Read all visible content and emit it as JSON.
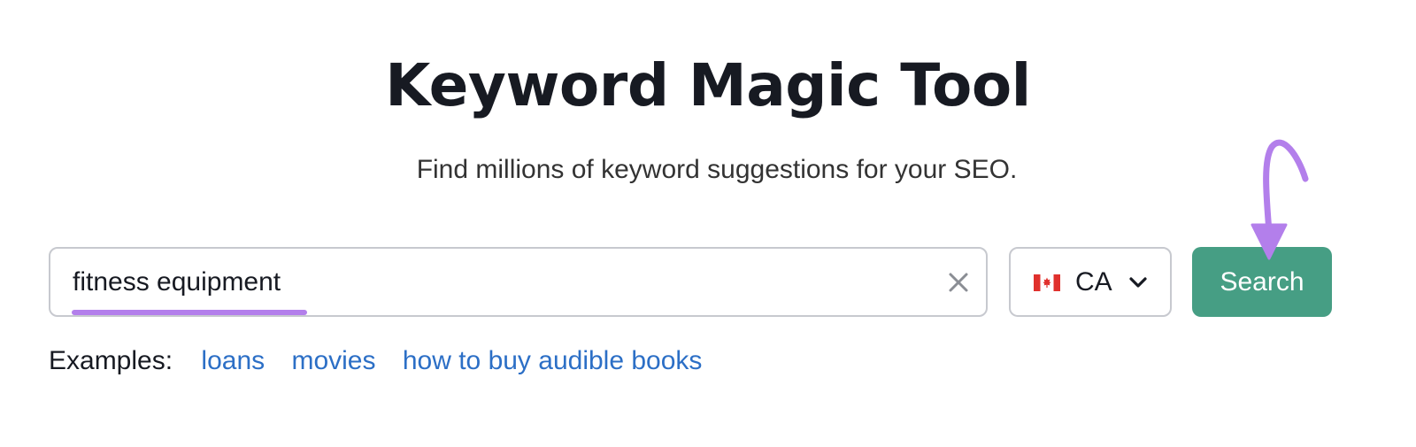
{
  "header": {
    "title": "Keyword Magic Tool",
    "subtitle": "Find millions of keyword suggestions for your SEO."
  },
  "search": {
    "value": "fitness equipment",
    "clear_icon": "close-icon"
  },
  "country": {
    "code": "CA",
    "flag_icon": "canada-flag-icon",
    "dropdown_icon": "chevron-down-icon"
  },
  "search_button": {
    "label": "Search"
  },
  "examples": {
    "label": "Examples:",
    "links": [
      "loans",
      "movies",
      "how to buy audible books"
    ]
  },
  "colors": {
    "accent_green": "#469e84",
    "link_blue": "#2c6fc6",
    "annotation_purple": "#b37feb",
    "title_text": "#171a22",
    "border": "#c7c9cf"
  }
}
